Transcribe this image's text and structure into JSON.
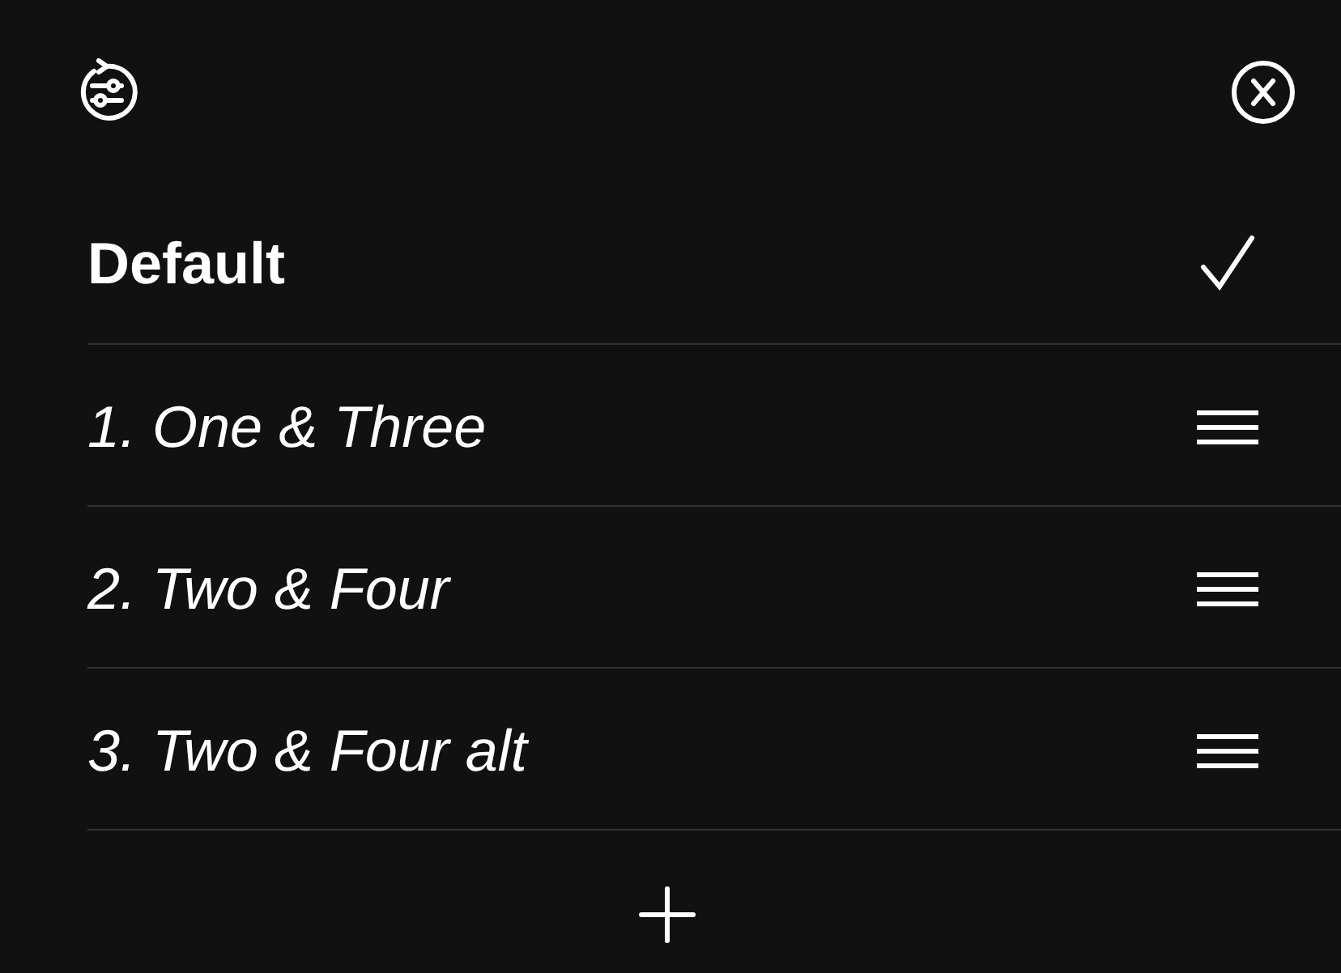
{
  "presets": [
    {
      "label": "Default",
      "kind": "default",
      "selected": true
    },
    {
      "label": "1. One & Three",
      "kind": "preset",
      "selected": false
    },
    {
      "label": "2. Two & Four",
      "kind": "preset",
      "selected": false
    },
    {
      "label": "3. Two & Four alt",
      "kind": "preset",
      "selected": false
    }
  ]
}
